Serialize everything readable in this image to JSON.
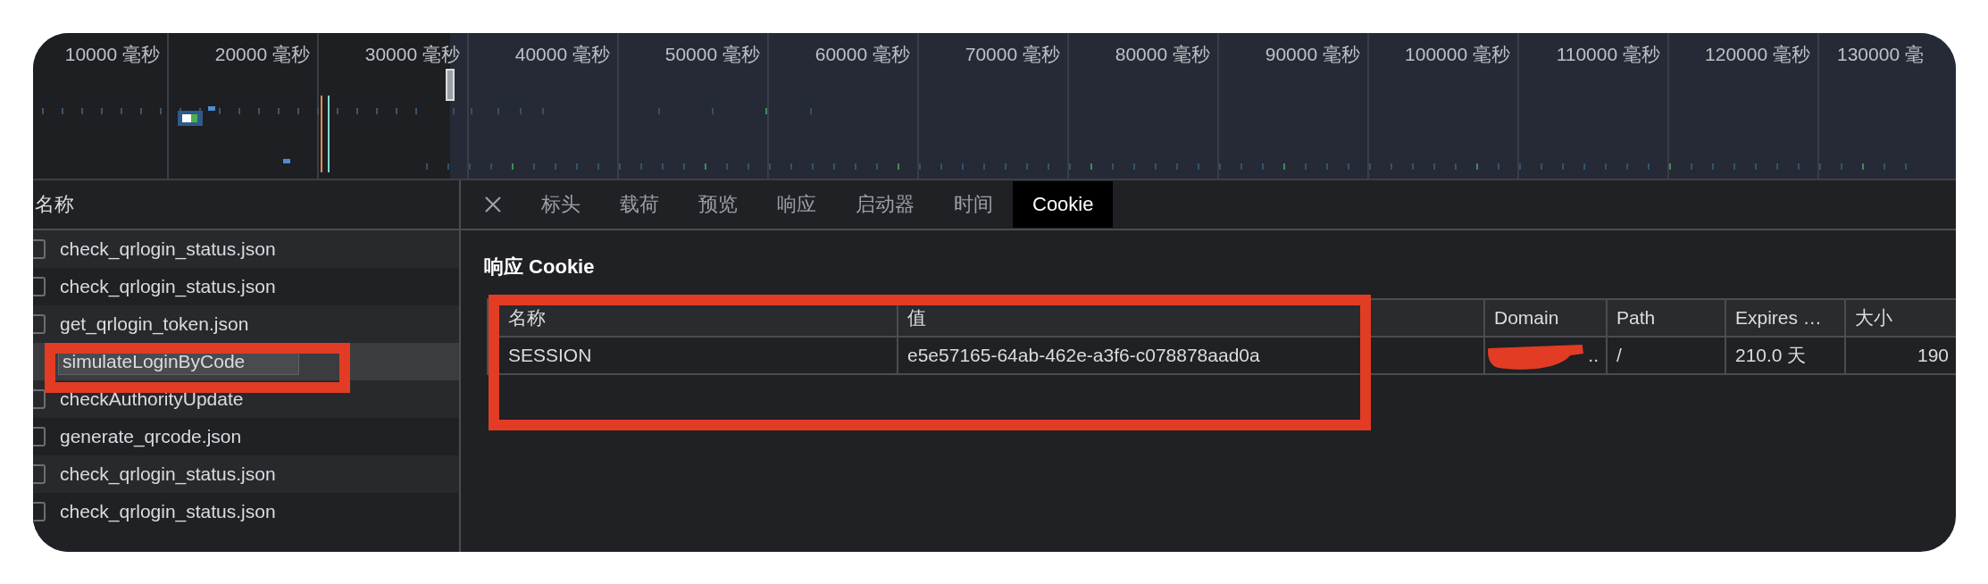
{
  "timeline": {
    "ticks": [
      "10000 毫秒",
      "20000 毫秒",
      "30000 毫秒",
      "40000 毫秒",
      "50000 毫秒",
      "60000 毫秒",
      "70000 毫秒",
      "80000 毫秒",
      "90000 毫秒",
      "100000 毫秒",
      "110000 毫秒",
      "120000 毫秒",
      "130000 毫"
    ]
  },
  "request_list": {
    "header": "名称",
    "rows": [
      {
        "name": "check_qrlogin_status.json",
        "selected": false
      },
      {
        "name": "check_qrlogin_status.json",
        "selected": false
      },
      {
        "name": "get_qrlogin_token.json",
        "selected": false
      },
      {
        "name": "simulateLoginByCode",
        "selected": true
      },
      {
        "name": "checkAuthorityUpdate",
        "selected": false
      },
      {
        "name": "generate_qrcode.json",
        "selected": false
      },
      {
        "name": "check_qrlogin_status.json",
        "selected": false
      },
      {
        "name": "check_qrlogin_status.json",
        "selected": false
      }
    ]
  },
  "details": {
    "tabs": [
      {
        "label": "标头",
        "selected": false
      },
      {
        "label": "载荷",
        "selected": false
      },
      {
        "label": "预览",
        "selected": false
      },
      {
        "label": "响应",
        "selected": false
      },
      {
        "label": "启动器",
        "selected": false
      },
      {
        "label": "时间",
        "selected": false
      },
      {
        "label": "Cookie",
        "selected": true
      }
    ],
    "section_title": "响应 Cookie",
    "cookie_table": {
      "columns": [
        "名称",
        "值",
        "Domain",
        "Path",
        "Expires …",
        "大小"
      ],
      "rows": [
        [
          "SESSION",
          "e5e57165-64ab-462e-a3f6-c078878aad0a",
          "..",
          "/",
          "210.0 天",
          "190"
        ]
      ]
    }
  }
}
